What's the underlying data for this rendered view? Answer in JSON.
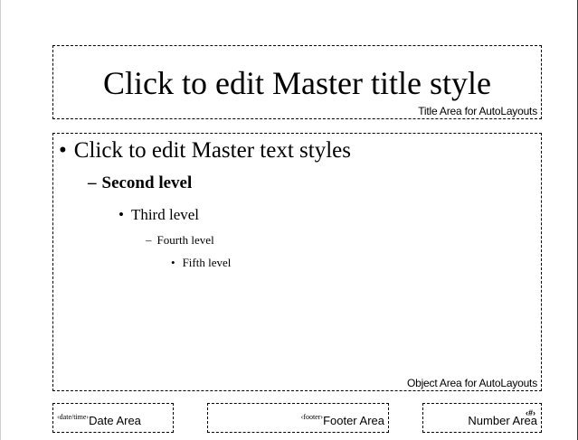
{
  "title_area": {
    "text": "Click to edit Master title style",
    "label": "Title Area for AutoLayouts"
  },
  "object_area": {
    "levels": [
      {
        "marker": "•",
        "text": "Click to edit Master text styles"
      },
      {
        "marker": "–",
        "text": "Second level"
      },
      {
        "marker": "•",
        "text": "Third level"
      },
      {
        "marker": "–",
        "text": "Fourth level"
      },
      {
        "marker": "•",
        "text": "Fifth level"
      }
    ],
    "label": "Object Area for AutoLayouts"
  },
  "date_area": {
    "field": "‹date/time›",
    "label": "Date Area"
  },
  "footer_area": {
    "field": "‹footer›",
    "label": "Footer Area"
  },
  "number_area": {
    "field": "‹#›",
    "label": "Number Area"
  }
}
